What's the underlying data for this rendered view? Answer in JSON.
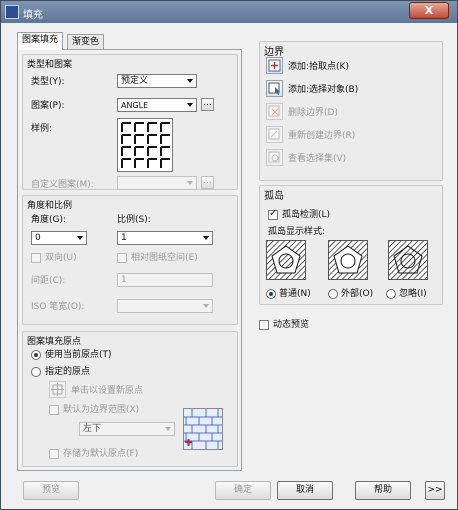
{
  "window": {
    "title": "填充",
    "close_label": "X"
  },
  "tabs": {
    "hatch": "图案填充",
    "gradient": "渐变色"
  },
  "type_pattern": {
    "group_title": "类型和图案",
    "type_label": "类型(Y):",
    "type_value": "预定义",
    "pattern_label": "图案(P):",
    "pattern_value": "ANGLE",
    "sample_label": "样例:",
    "custom_label": "自定义图案(M):",
    "custom_value": "",
    "browse_label": "..."
  },
  "angle_scale": {
    "group_title": "角度和比例",
    "angle_label": "角度(G):",
    "angle_value": "0",
    "scale_label": "比例(S):",
    "scale_value": "1",
    "double_label": "双向(U)",
    "relative_label": "相对图纸空间(E)",
    "spacing_label": "间距(C):",
    "spacing_value": "1",
    "iso_label": "ISO 笔宽(O):",
    "iso_value": ""
  },
  "origin": {
    "group_title": "图案填充原点",
    "use_current": "使用当前原点(T)",
    "specified": "指定的原点",
    "click_set": "单击以设置新原点",
    "default_extents": "默认为边界范围(X)",
    "position_value": "左下",
    "store_default": "存储为默认原点(F)"
  },
  "boundaries": {
    "group_title": "边界",
    "add_pick": "添加:拾取点(K)",
    "add_select": "添加:选择对象(B)",
    "remove": "删除边界(D)",
    "recreate": "重新创建边界(R)",
    "view_selection": "查看选择集(V)"
  },
  "islands": {
    "group_title": "孤岛",
    "detect_label": "孤岛检测(L)",
    "style_label": "孤岛显示样式:",
    "normal": "普通(N)",
    "outer": "外部(O)",
    "ignore": "忽略(I)"
  },
  "dynamic_preview": "动态预览",
  "footer": {
    "preview": "预览",
    "ok": "确定",
    "cancel": "取消",
    "help": "帮助",
    "more": ">>"
  }
}
